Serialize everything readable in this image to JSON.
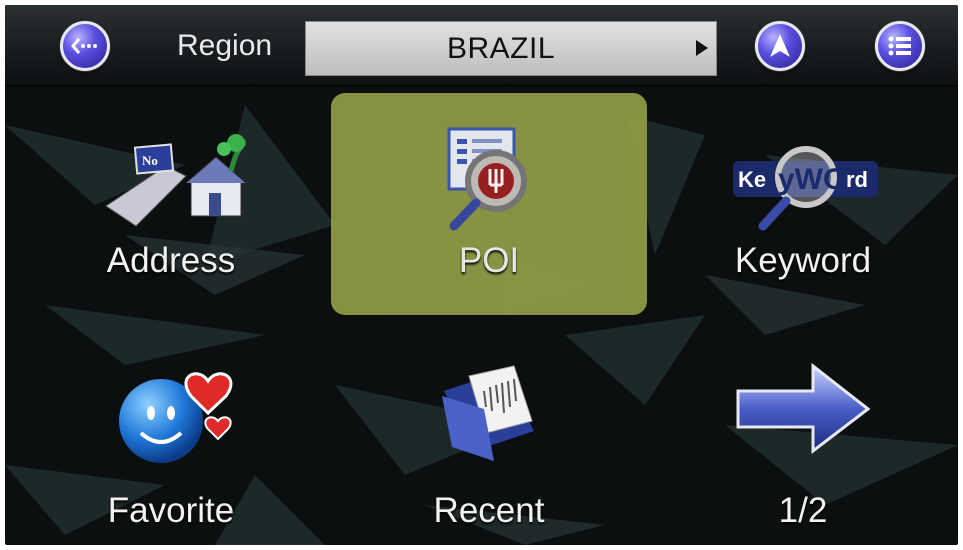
{
  "header": {
    "back_icon": "back-ellipsis-icon",
    "region_label": "Region",
    "region_value": "BRAZIL",
    "navigate_icon": "navigation-arrow-icon",
    "menu_icon": "list-menu-icon"
  },
  "tiles": [
    {
      "label": "Address",
      "icon": "address-icon",
      "selected": false
    },
    {
      "label": "POI",
      "icon": "poi-magnifier-icon",
      "selected": true
    },
    {
      "label": "Keyword",
      "icon": "keyword-magnifier-icon",
      "selected": false
    },
    {
      "label": "Favorite",
      "icon": "favorite-smiley-heart-icon",
      "selected": false
    },
    {
      "label": "Recent",
      "icon": "recent-folder-icon",
      "selected": false
    },
    {
      "label": "1/2",
      "icon": "next-page-arrow-icon",
      "selected": false
    }
  ],
  "colors": {
    "selected_tile": "#8e9a45",
    "button_accent": "#5a4fe0"
  }
}
